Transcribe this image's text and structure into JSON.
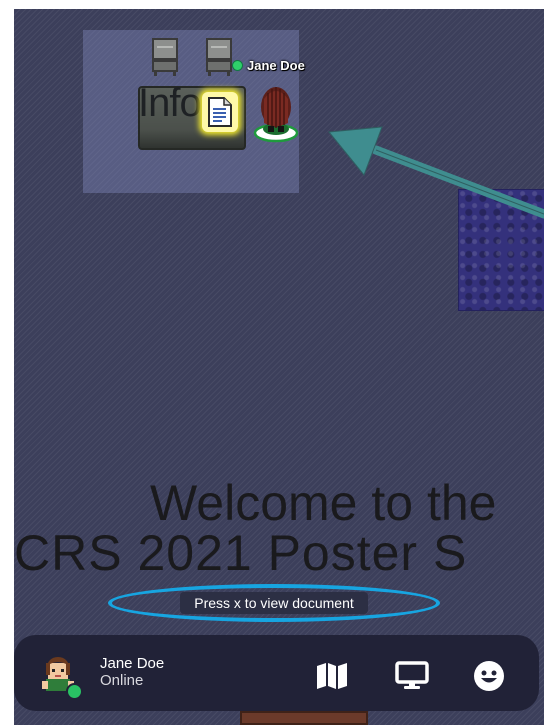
{
  "game": {
    "table_label": "Info",
    "player_name": "Jane Doe",
    "welcome_line1": "Welcome to the",
    "welcome_line2": "CRS 2021 Poster S",
    "prompt": "Press x to view document"
  },
  "bottom_bar": {
    "user_name": "Jane Doe",
    "user_status": "Online",
    "status_color": "#29c264",
    "buttons": [
      "map-icon",
      "screen-share-icon",
      "emote-icon"
    ]
  },
  "colors": {
    "floor": "#3c3f5b",
    "highlight_ellipse": "#17a5e1",
    "arrow": "#3f8d8f",
    "bar_bg": "#212237"
  }
}
